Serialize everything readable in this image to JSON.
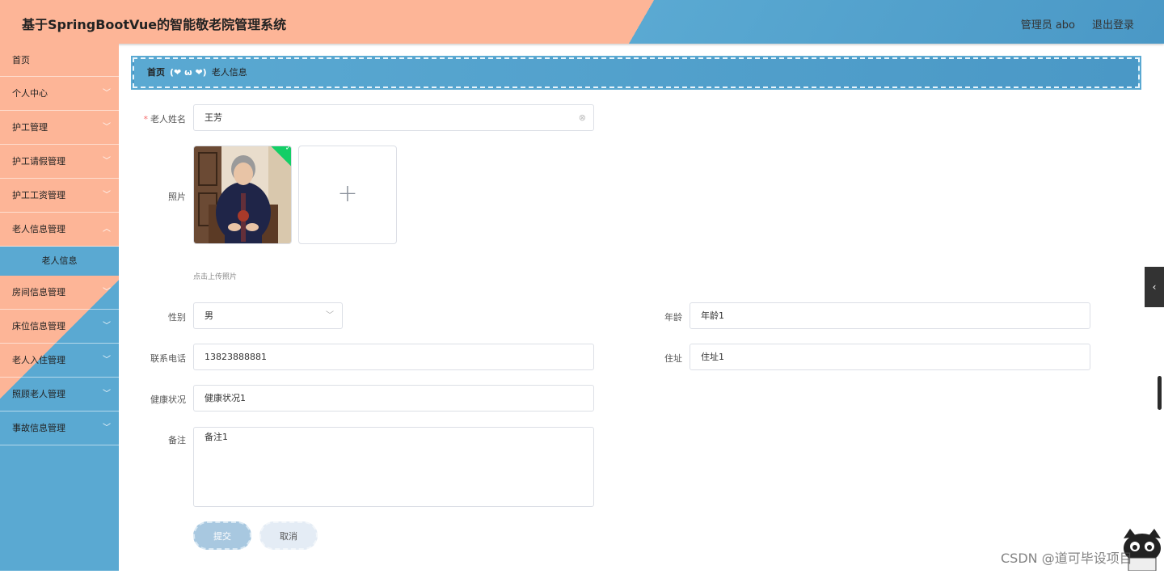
{
  "header": {
    "title": "基于SpringBootVue的智能敬老院管理系统",
    "user": "管理员 abo",
    "logout": "退出登录"
  },
  "sidebar": {
    "items": [
      {
        "label": "首页"
      },
      {
        "label": "个人中心"
      },
      {
        "label": "护工管理"
      },
      {
        "label": "护工请假管理"
      },
      {
        "label": "护工工资管理"
      },
      {
        "label": "老人信息管理"
      },
      {
        "label": "房间信息管理"
      },
      {
        "label": "床位信息管理"
      },
      {
        "label": "老人入住管理"
      },
      {
        "label": "照顾老人管理"
      },
      {
        "label": "事故信息管理"
      }
    ],
    "submenu_active": "老人信息"
  },
  "breadcrumb": {
    "home": "首页",
    "separator": "(❤ ω ❤)",
    "current": "老人信息"
  },
  "form": {
    "name": {
      "label": "老人姓名",
      "value": "王芳"
    },
    "photo": {
      "label": "照片",
      "hint": "点击上传照片"
    },
    "gender": {
      "label": "性别",
      "value": "男"
    },
    "age": {
      "label": "年龄",
      "value": "年龄1"
    },
    "phone": {
      "label": "联系电话",
      "value": "13823888881"
    },
    "address": {
      "label": "住址",
      "value": "住址1"
    },
    "health": {
      "label": "健康状况",
      "value": "健康状况1"
    },
    "remark": {
      "label": "备注",
      "value": "备注1"
    },
    "submit": "提交",
    "cancel": "取消"
  },
  "icons": {
    "clear": "circle-x-icon",
    "dropdown": "chevron-down-icon",
    "upload_success": "check-icon",
    "add": "plus-icon"
  },
  "colors": {
    "sidebar_peach": "#fdb597",
    "accent_blue": "#5aa9d2",
    "success": "#13ce66"
  },
  "watermark": "CSDN @道可毕设项目"
}
